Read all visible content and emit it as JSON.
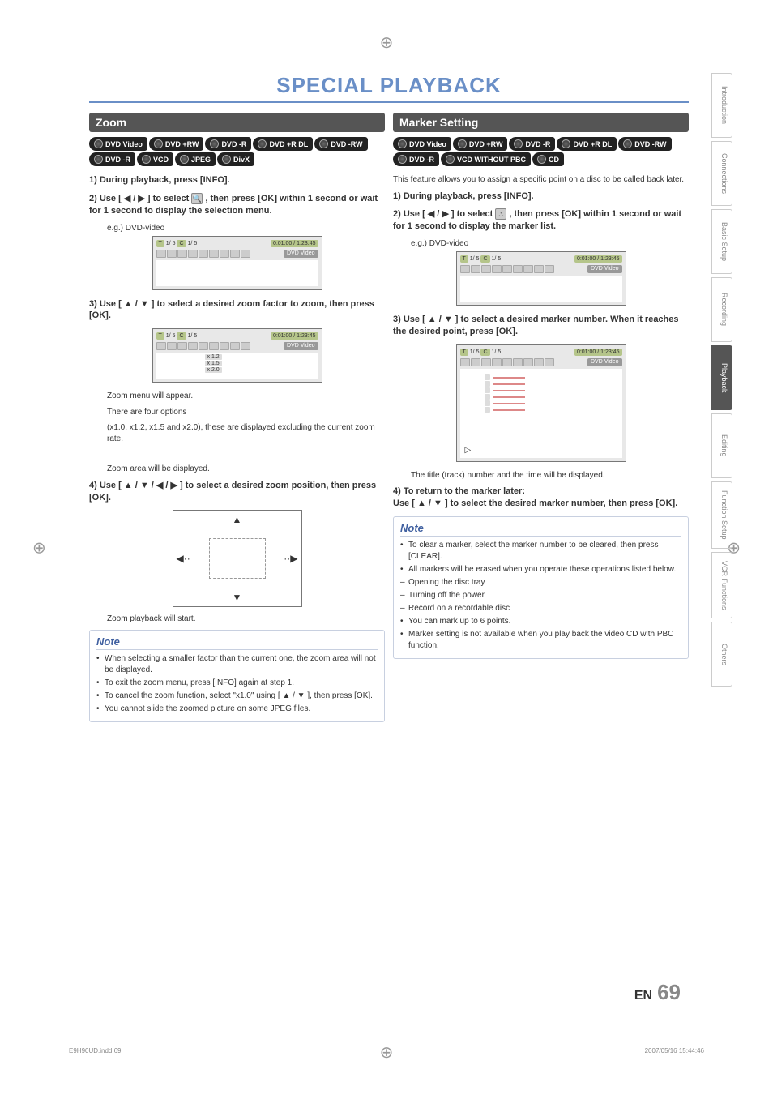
{
  "title": "SPECIAL PLAYBACK",
  "left": {
    "header": "Zoom",
    "badges": [
      "DVD Video",
      "DVD +RW",
      "DVD -R",
      "DVD +R DL",
      "DVD -RW",
      "DVD -R",
      "VCD",
      "JPEG",
      "DivX"
    ],
    "step1": "1) During playback, press [INFO].",
    "step2_a": "2) Use [ ◀ / ▶ ] to select ",
    "step2_b": " , then press [OK] within 1 second or wait for 1 second to display the selection menu.",
    "eg": "e.g.) DVD-video",
    "step3": "3) Use [ ▲ / ▼ ] to select a desired zoom factor to zoom, then press [OK].",
    "zoom_opts": [
      "x 1.2",
      "x 1.5",
      "x 2.0"
    ],
    "p1": "Zoom menu will appear.",
    "p2": "There are four options",
    "p3": "(x1.0, x1.2, x1.5 and x2.0), these are displayed excluding the current zoom rate.",
    "p4": "Zoom area will be displayed.",
    "step4": "4) Use [ ▲ / ▼ /  ◀ / ▶ ] to select a desired zoom position, then press [OK].",
    "p5": "Zoom playback will start.",
    "note_title": "Note",
    "notes": [
      {
        "t": "bullet",
        "text": "When selecting a smaller factor than the current one, the zoom area will not be displayed."
      },
      {
        "t": "bullet",
        "text": "To exit the zoom menu, press [INFO] again at step 1."
      },
      {
        "t": "bullet",
        "text": "To cancel the zoom function, select \"x1.0\" using [ ▲ / ▼ ], then press [OK]."
      },
      {
        "t": "bullet",
        "text": "You cannot slide the zoomed picture on some JPEG files."
      }
    ]
  },
  "right": {
    "header": "Marker Setting",
    "badges": [
      "DVD Video",
      "DVD +RW",
      "DVD -R",
      "DVD +R DL",
      "DVD -RW",
      "DVD -R",
      "VCD WITHOUT PBC",
      "CD"
    ],
    "intro": "This feature allows you to assign a specific point on a disc to be called back later.",
    "step1": "1) During playback, press [INFO].",
    "step2_a": "2) Use [ ◀ / ▶ ] to select ",
    "step2_b": " , then press [OK] within 1 second or wait for 1 second to display the marker list.",
    "eg": "e.g.) DVD-video",
    "step3": "3) Use [ ▲ / ▼ ] to select a desired marker number. When it reaches the desired point, press [OK].",
    "p1": "The title (track) number and the time will be displayed.",
    "step4": "4) To return to the marker later:",
    "step4_b": "Use [ ▲ / ▼ ] to select the desired marker number, then press [OK].",
    "note_title": "Note",
    "notes": [
      {
        "t": "bullet",
        "text": "To clear a marker, select the marker number to be cleared, then press [CLEAR]."
      },
      {
        "t": "bullet",
        "text": "All markers will be erased when you operate these operations listed below."
      },
      {
        "t": "dash",
        "text": "Opening the disc tray"
      },
      {
        "t": "dash",
        "text": "Turning off the power"
      },
      {
        "t": "dash",
        "text": "Record on a recordable disc"
      },
      {
        "t": "bullet",
        "text": "You can mark up to 6 points."
      },
      {
        "t": "bullet",
        "text": "Marker setting is not available when you play back the video CD with PBC function."
      }
    ]
  },
  "osd": {
    "t": "T",
    "c": "C",
    "nums1": "1/  5",
    "nums2": "1/  5",
    "time": "0:01:00 / 1:23:45",
    "dvd_tag": "DVD Video",
    "play": "▷"
  },
  "side_tabs": [
    "Introduction",
    "Connections",
    "Basic Setup",
    "Recording",
    "Playback",
    "Editing",
    "Function Setup",
    "VCR Functions",
    "Others"
  ],
  "active_tab": "Playback",
  "page_label": "EN",
  "page_num": "69",
  "footer_left": "E9H90UD.indd   69",
  "footer_right": "2007/05/16   15:44:46"
}
